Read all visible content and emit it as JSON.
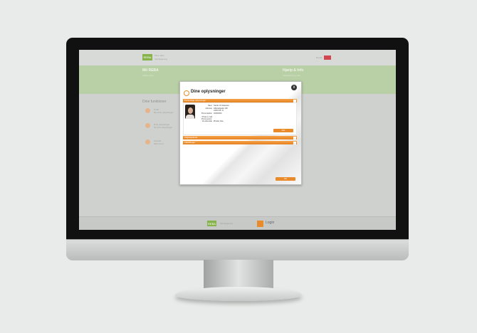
{
  "header": {
    "logo_text": "REBA",
    "app_name": "Mine sider",
    "app_sub": "Selvbetjening",
    "lang_label": "Dansk"
  },
  "band": {
    "left_title": "Mit REBA",
    "left_sub": "Velkommen",
    "right_title": "Hjælp & Info",
    "right_sub": "Spørgsmål og svar"
  },
  "section": {
    "title": "Dine funktioner"
  },
  "items": [
    {
      "title": "Profil",
      "sub": "Ret dine oplysninger"
    },
    {
      "title": "Dine oplysninger",
      "sub": "Se dine oplysninger"
    },
    {
      "title": "Kontakt",
      "sub": "Skriv til os"
    }
  ],
  "footer": {
    "logo_text": "REBA",
    "center_text": "Selvbetjening",
    "login_label": "Login"
  },
  "dialog": {
    "title": "Dine oplysninger",
    "close_label": "x",
    "sections": [
      {
        "label": "Personlige oplysninger",
        "expanded": true
      },
      {
        "label": "Adgangskode",
        "expanded": false
      },
      {
        "label": "Indstillinger",
        "expanded": false
      }
    ],
    "fields": [
      {
        "label": "Navn",
        "value": "Sarah Christiansen"
      },
      {
        "label": "Adresse",
        "value": "Hillerødgade 100"
      },
      {
        "label": "",
        "value": "2200 Kbh N"
      },
      {
        "label": "Privat telefon",
        "value": "40000000"
      },
      {
        "label": "Privat e-mail",
        "value": ""
      },
      {
        "label": "Privat postnr.",
        "value": ""
      },
      {
        "label": "Via afsendte",
        "value": "Ønsker ikke"
      }
    ],
    "edit_button": "Ret",
    "ok_button": "OK"
  },
  "colors": {
    "accent": "#e98b2a",
    "brand_green": "#86b34b",
    "page_background": "#e9ebea"
  }
}
